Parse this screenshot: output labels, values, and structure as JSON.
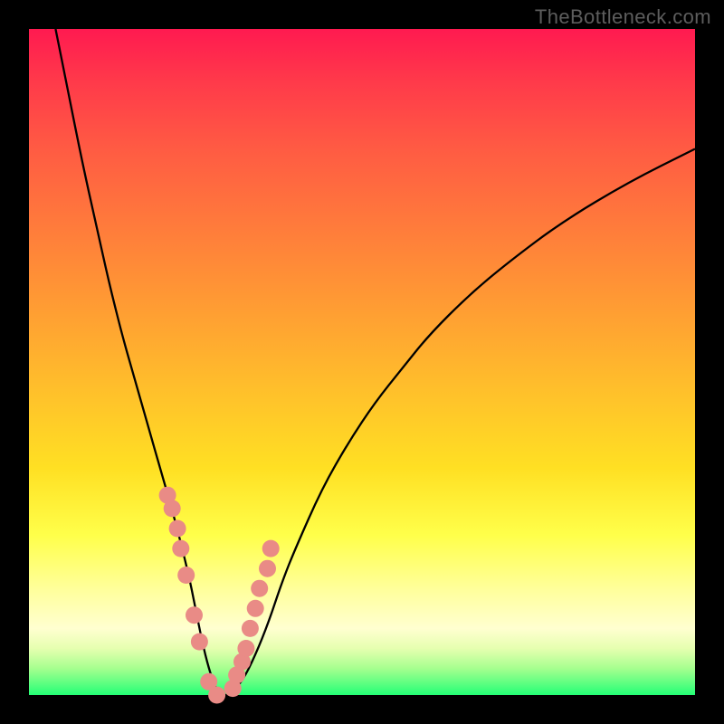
{
  "watermark": "TheBottleneck.com",
  "colors": {
    "frame": "#000000",
    "gradient_top": "#ff1a50",
    "gradient_bottom": "#24ff76",
    "curve": "#000000",
    "dots": "#e98b86"
  },
  "chart_data": {
    "type": "line",
    "title": "",
    "xlabel": "",
    "ylabel": "",
    "xlim": [
      0,
      100
    ],
    "ylim": [
      0,
      100
    ],
    "series": [
      {
        "name": "bottleneck-curve",
        "x": [
          4,
          6,
          8,
          10,
          12,
          14,
          16,
          18,
          20,
          22,
          24,
          25,
          26,
          27,
          28,
          29,
          30,
          32,
          34,
          36,
          38,
          40,
          44,
          48,
          52,
          56,
          60,
          66,
          72,
          80,
          90,
          100
        ],
        "y": [
          100,
          90,
          80,
          71,
          62,
          54,
          47,
          40,
          33,
          26,
          18,
          13,
          8,
          4,
          1,
          0,
          0,
          2,
          6,
          11,
          17,
          22,
          31,
          38,
          44,
          49,
          54,
          60,
          65,
          71,
          77,
          82
        ]
      }
    ],
    "markers": {
      "name": "highlighted-points",
      "x": [
        20.8,
        21.5,
        22.3,
        22.8,
        23.6,
        24.8,
        25.6,
        27.0,
        28.2,
        30.6,
        31.2,
        32.0,
        32.6,
        33.2,
        34.0,
        34.6,
        35.8,
        36.3
      ],
      "y": [
        30,
        28,
        25,
        22,
        18,
        12,
        8,
        2,
        0,
        1,
        3,
        5,
        7,
        10,
        13,
        16,
        19,
        22
      ]
    }
  }
}
